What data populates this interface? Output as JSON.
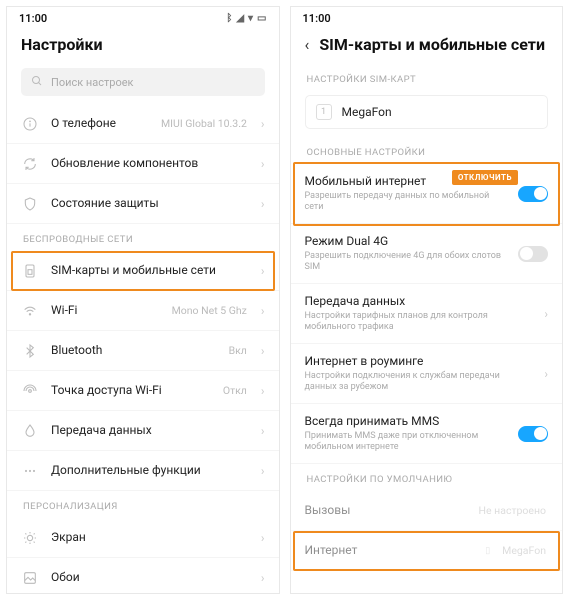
{
  "statusbar": {
    "time": "11:00"
  },
  "left": {
    "title": "Настройки",
    "search_placeholder": "Поиск настроек",
    "rows": {
      "about": {
        "label": "О телефоне",
        "value": "MIUI Global 10.3.2"
      },
      "update": {
        "label": "Обновление компонентов"
      },
      "security": {
        "label": "Состояние защиты"
      }
    },
    "section_wireless": "БЕСПРОВОДНЫЕ СЕТИ",
    "wireless": {
      "sim": {
        "label": "SIM-карты и мобильные сети"
      },
      "wifi": {
        "label": "Wi-Fi",
        "value": "Mono Net 5 Ghz"
      },
      "bluetooth": {
        "label": "Bluetooth",
        "value": "Вкл"
      },
      "hotspot": {
        "label": "Точка доступа Wi-Fi",
        "value": "Откл"
      },
      "usage": {
        "label": "Передача данных"
      },
      "more": {
        "label": "Дополнительные функции"
      }
    },
    "section_personal": "ПЕРСОНАЛИЗАЦИЯ",
    "personal": {
      "screen": {
        "label": "Экран"
      },
      "wallpaper": {
        "label": "Обои"
      }
    }
  },
  "right": {
    "title": "SIM-карты и мобильные сети",
    "section_sim": "НАСТРОЙКИ SIM-КАРТ",
    "sim": {
      "num": "1",
      "name": "MegaFon"
    },
    "section_main": "ОСНОВНЫЕ НАСТРОЙКИ",
    "badge_disable": "ОТКЛЮЧИТЬ",
    "main": {
      "mobile_data": {
        "label": "Мобильный интернет",
        "sub": "Разрешить передачу данных по мобильной сети"
      },
      "dual4g": {
        "label": "Режим Dual 4G",
        "sub": "Разрешить подключение 4G для обоих слотов SIM"
      },
      "data": {
        "label": "Передача данных",
        "sub": "Настройки тарифных планов для контроля мобильного трафика"
      },
      "roaming": {
        "label": "Интернет в роуминге",
        "sub": "Настройки подключения к службам передачи данных за рубежом"
      },
      "mms": {
        "label": "Всегда принимать MMS",
        "sub": "Принимать MMS даже при отключенном мобильном интернете"
      }
    },
    "section_defaults": "НАСТРОЙКИ ПО УМОЛЧАНИЮ",
    "defaults": {
      "calls": {
        "label": "Вызовы",
        "value": "Не настроено"
      },
      "internet": {
        "label": "Интернет",
        "value": "MegaFon"
      }
    }
  }
}
